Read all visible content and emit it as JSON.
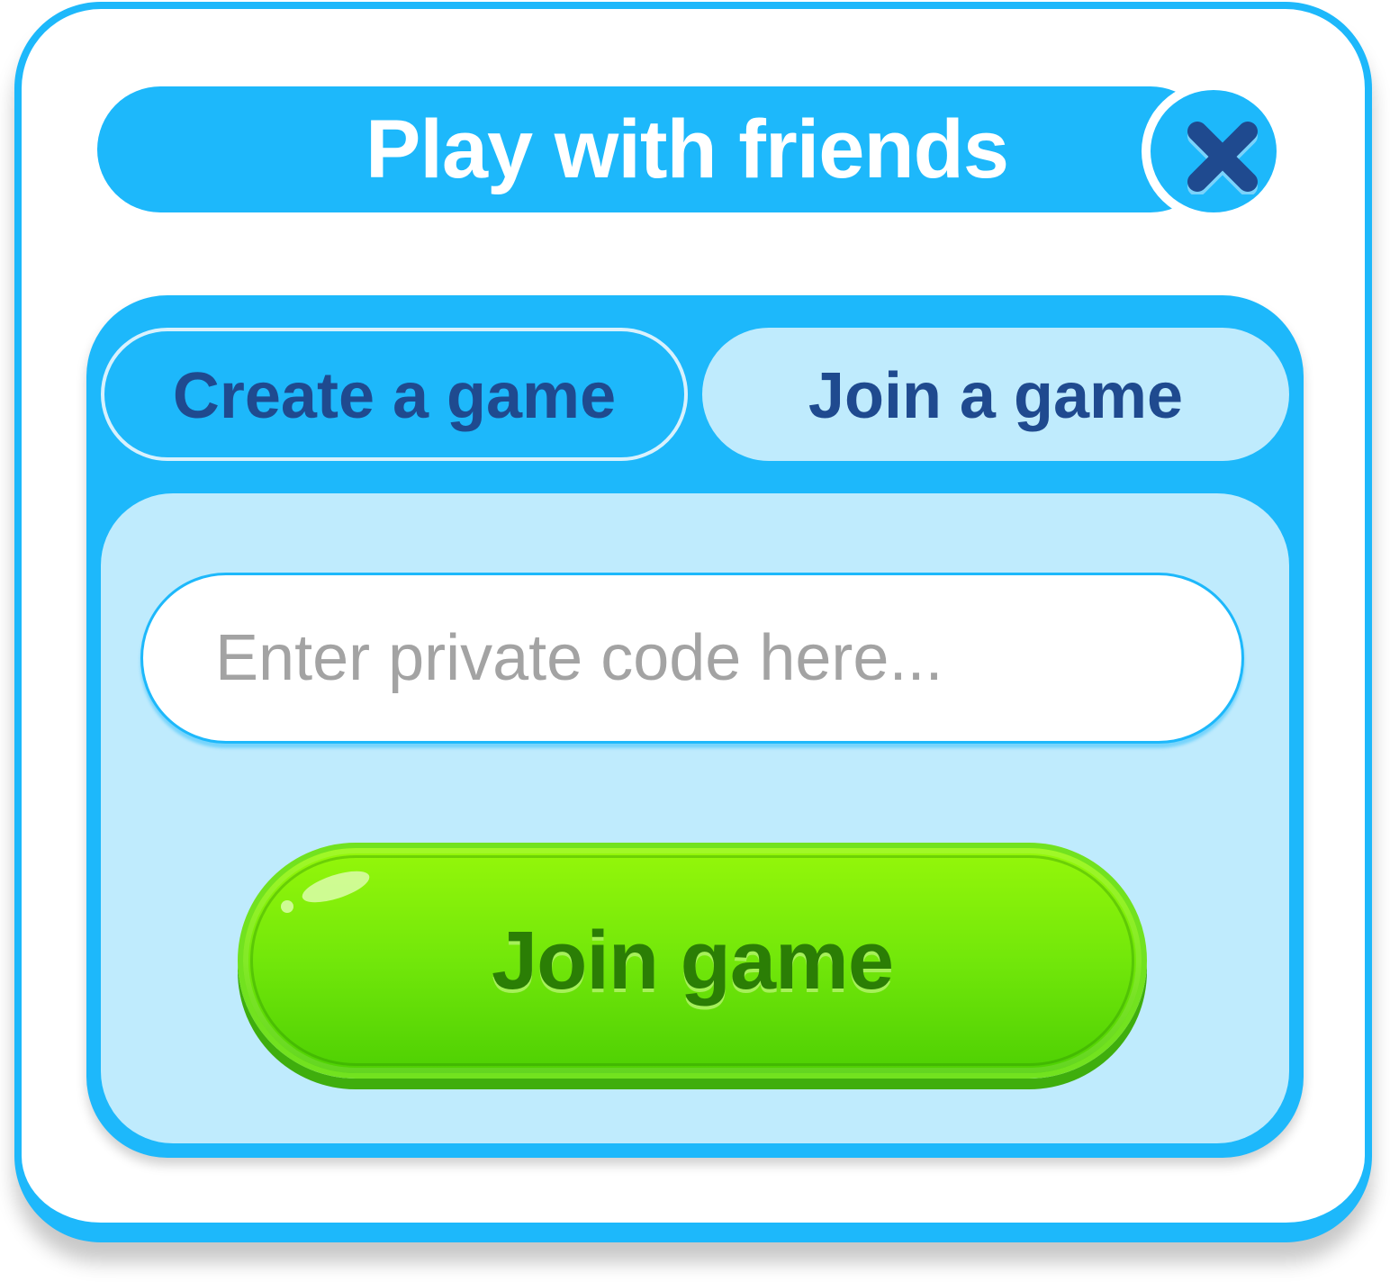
{
  "dialog": {
    "title": "Play with friends",
    "close_icon": "close-icon"
  },
  "tabs": [
    {
      "label": "Create a game",
      "selected": false
    },
    {
      "label": "Join a game",
      "selected": true
    }
  ],
  "join": {
    "code_placeholder": "Enter private code here...",
    "code_value": "",
    "submit_label": "Join game"
  },
  "colors": {
    "primary_blue": "#1db8fb",
    "light_blue": "#bfebfd",
    "dark_blue_text": "#1f4a8f",
    "green_button": "#72e70a",
    "green_text": "#2b7e05"
  }
}
